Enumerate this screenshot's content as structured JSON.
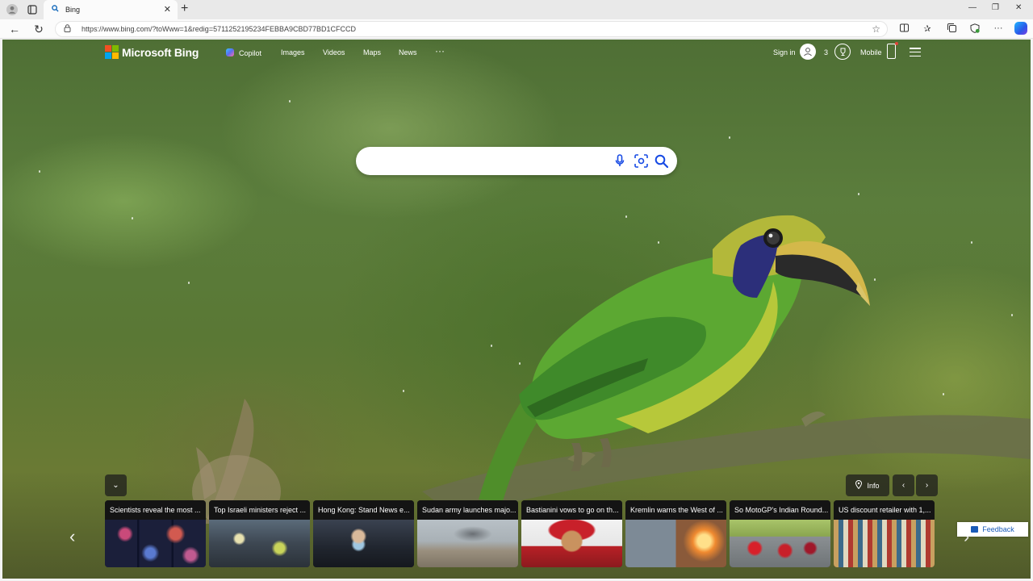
{
  "browser": {
    "tab_title": "Bing",
    "tab_favicon": "search-icon",
    "url": "https://www.bing.com/?toWww=1&redig=5711252195234FEBBA9CBD77BD1CFCCD"
  },
  "header": {
    "logo_text": "Microsoft Bing",
    "nav": {
      "copilot": "Copilot",
      "images": "Images",
      "videos": "Videos",
      "maps": "Maps",
      "news": "News",
      "more": "···"
    },
    "sign_in": "Sign in",
    "rewards_count": "3",
    "mobile": "Mobile"
  },
  "search": {
    "placeholder": "",
    "value": ""
  },
  "carousel": {
    "info_label": "Info",
    "cards": [
      {
        "title": "Scientists reveal the most ..."
      },
      {
        "title": "Top Israeli ministers reject ..."
      },
      {
        "title": "Hong Kong: Stand News e..."
      },
      {
        "title": "Sudan army launches majo..."
      },
      {
        "title": "Bastianini vows to go on th..."
      },
      {
        "title": "Kremlin warns the West of ..."
      },
      {
        "title": "So MotoGP's Indian Round..."
      },
      {
        "title": "US discount retailer with 1,..."
      }
    ]
  },
  "feedback_label": "Feedback",
  "colors": {
    "logo_red": "#f25022",
    "logo_green": "#7fba00",
    "logo_blue": "#00a4ef",
    "logo_yellow": "#ffb900",
    "accent_blue": "#1a5bb8",
    "icon_blue": "#174ae4"
  }
}
